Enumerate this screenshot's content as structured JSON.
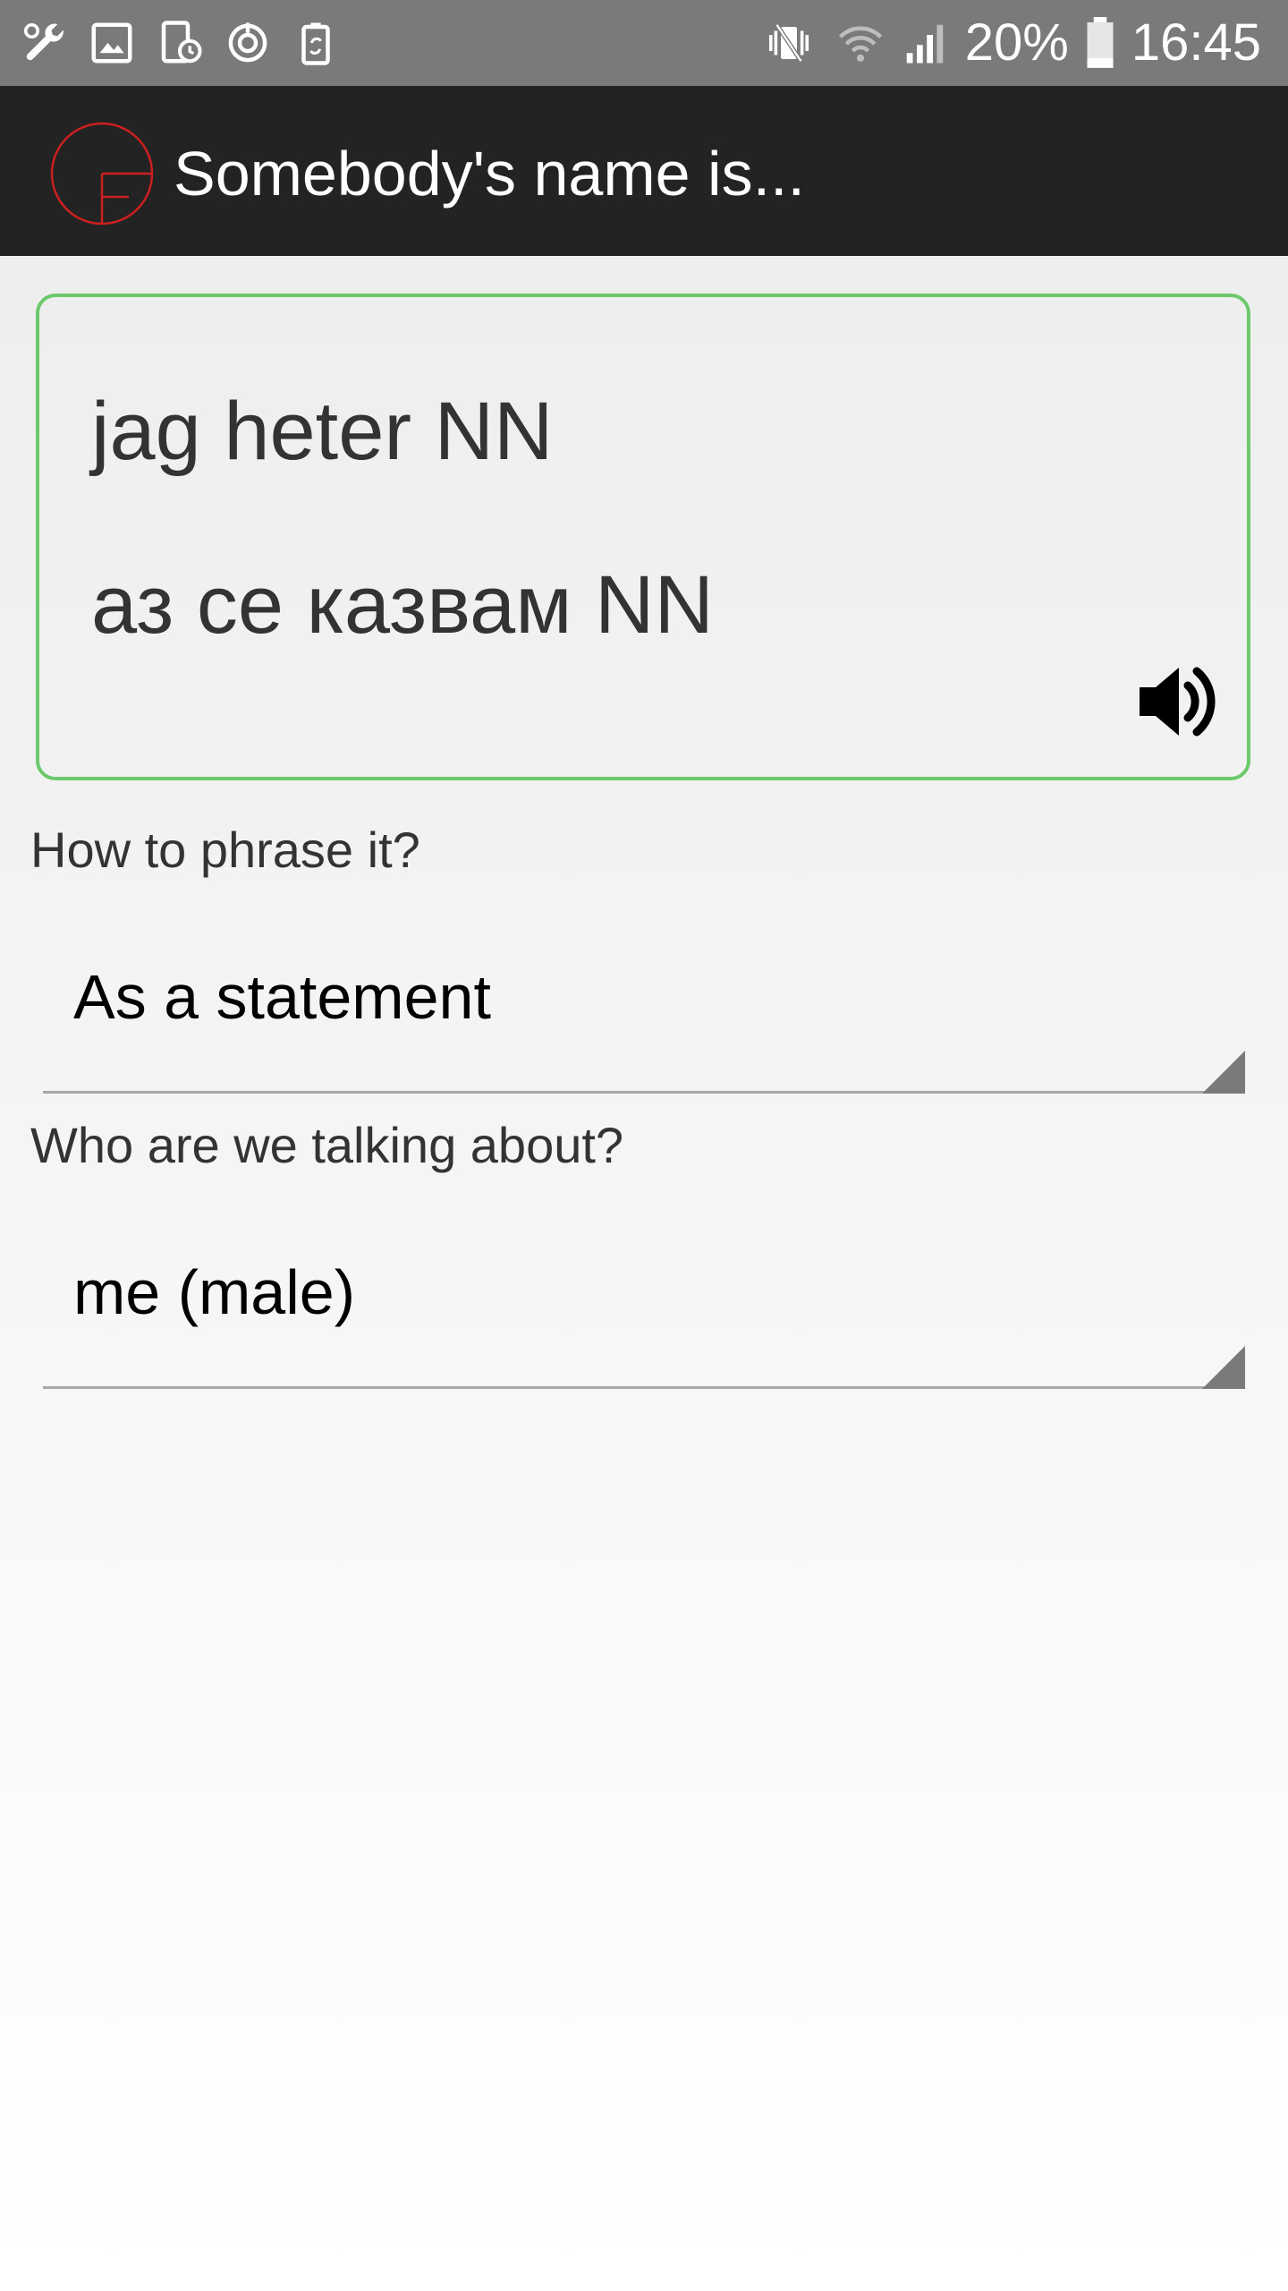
{
  "status_bar": {
    "battery_percent": "20%",
    "time": "16:45",
    "left_icons": [
      "wrench-icon",
      "image-icon",
      "phone-clock-icon",
      "sync-icon",
      "battery-recycle-icon"
    ],
    "right_icons": [
      "vibrate-mute-icon",
      "wifi-icon",
      "cell-signal-icon",
      "battery-icon"
    ]
  },
  "app_bar": {
    "title": "Somebody's name is...",
    "logo_color": "#cc1f1f"
  },
  "phrase_card": {
    "source_text": "jag heter NN",
    "translation_text": "аз се казвам NN",
    "speaker_icon": "speaker-icon",
    "border_color": "#6cc96c"
  },
  "options": {
    "phrase_label": "How to phrase it?",
    "phrase_value": "As a statement",
    "subject_label": "Who are we talking about?",
    "subject_value": "me (male)"
  }
}
